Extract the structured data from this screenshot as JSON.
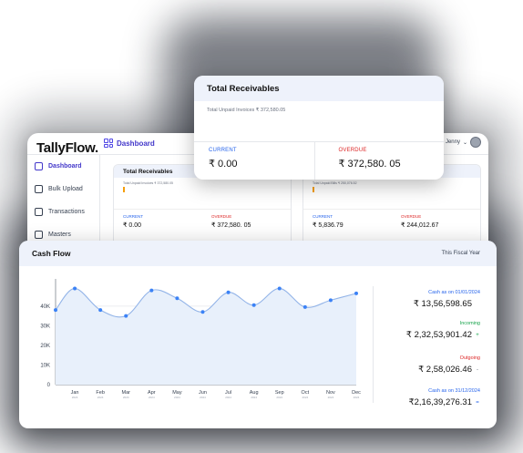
{
  "dashboard": {
    "logo": "TallyFlow.",
    "title": "Dashboard",
    "user_name": "Jenny",
    "sidebar": [
      {
        "label": "Dashboard",
        "icon": "grid-icon",
        "active": true
      },
      {
        "label": "Bulk Upload",
        "icon": "upload-icon",
        "active": false
      },
      {
        "label": "Transactions",
        "icon": "transactions-icon",
        "active": false
      },
      {
        "label": "Masters",
        "icon": "masters-icon",
        "active": false
      }
    ],
    "cards": [
      {
        "title": "Total Receivables",
        "subtitle": "Total Unpaid Invoices ₹ 372,580.05",
        "current_label": "CURRENT",
        "current_value": "₹ 0.00",
        "overdue_label": "OVERDUE",
        "overdue_value": "₹ 372,580. 05"
      },
      {
        "title": "",
        "subtitle": "Total Unpaid Bills ₹ 250,076.52",
        "current_label": "CURRENT",
        "current_value": "₹ 5,836.79",
        "overdue_label": "OVERDUE",
        "overdue_value": "₹ 244,012.67"
      }
    ]
  },
  "receivables": {
    "title": "Total Receivables",
    "subtitle": "Total Unpaid Invoices ₹ 372,580.05",
    "current_label": "CURRENT",
    "current_value": "₹ 0.00",
    "overdue_label": "OVERDUE",
    "overdue_value": "₹ 372,580. 05"
  },
  "cash_flow": {
    "title": "Cash Flow",
    "period": "This Fiscal Year",
    "summary": [
      {
        "label": "Cash as on 01/01/2024",
        "value": "₹ 13,56,598.65",
        "color": "#2563eb",
        "arrow": ""
      },
      {
        "label": "Incoming",
        "value": "₹ 2,32,53,901.42",
        "color": "#16a34a",
        "arrow": "+"
      },
      {
        "label": "Outgoing",
        "value": "₹ 2,58,026.46",
        "color": "#dc2626",
        "arrow": "-"
      },
      {
        "label": "Cash as on 31/12/2024",
        "value": "₹2,16,39,276.31",
        "color": "#2563eb",
        "arrow": "="
      }
    ]
  },
  "chart_data": {
    "type": "line",
    "categories": [
      "Jan",
      "Feb",
      "Mar",
      "Apr",
      "May",
      "Jun",
      "Jul",
      "Aug",
      "Sep",
      "Oct",
      "Nov",
      "Dec"
    ],
    "year_labels": [
      "2024",
      "2024",
      "2024",
      "2024",
      "2024",
      "2024",
      "2024",
      "2024",
      "2024",
      "2024",
      "2024",
      "2024"
    ],
    "start_value": 38000,
    "values": [
      49000,
      38000,
      35000,
      48000,
      44000,
      37000,
      47000,
      40500,
      49000,
      39500,
      43000,
      46500
    ],
    "yticks": [
      0,
      10000,
      20000,
      30000,
      40000
    ],
    "ytick_labels": [
      "0",
      "10K",
      "20K",
      "30K",
      "40K"
    ],
    "ylim": [
      0,
      52000
    ],
    "grid": true,
    "line_color": "#93b4e8",
    "point_color": "#3b82f6",
    "fill_color": "#e8f0fb"
  }
}
